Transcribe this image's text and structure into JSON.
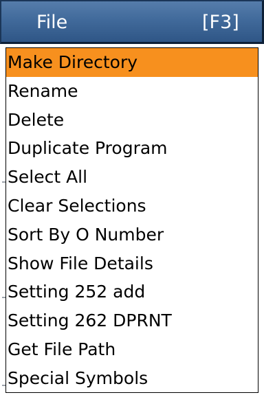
{
  "menu": {
    "title": "File",
    "shortcut": "[F3]",
    "header_color": "#416a9b",
    "selected_color": "#f7901e",
    "selected_index": 0,
    "items": [
      {
        "label": "Make Directory"
      },
      {
        "label": "Rename"
      },
      {
        "label": "Delete"
      },
      {
        "label": "Duplicate Program"
      },
      {
        "label": "Select All"
      },
      {
        "label": "Clear Selections"
      },
      {
        "label": "Sort By O Number"
      },
      {
        "label": "Show File Details"
      },
      {
        "label": "Setting 252 add"
      },
      {
        "label": "Setting 262 DPRNT"
      },
      {
        "label": "Get File Path"
      },
      {
        "label": "Special Symbols"
      }
    ]
  }
}
